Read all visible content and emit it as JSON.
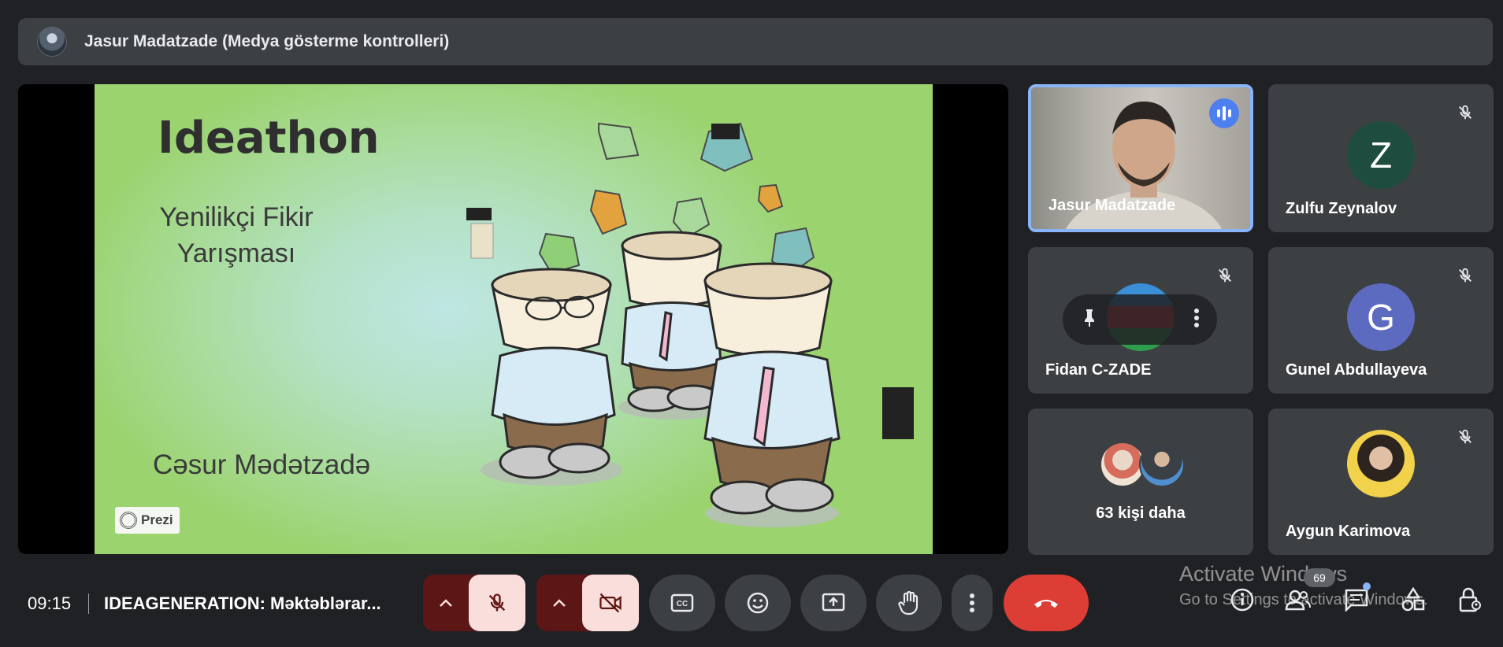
{
  "header": {
    "title": "Jasur Madatzade (Medya gösterme kontrolleri)"
  },
  "slide": {
    "title": "Ideathon",
    "subtitle_line1": "Yenilikçi Fikir",
    "subtitle_line2": "Yarışması",
    "author": "Cəsur Mədətzadə",
    "brand": "Prezi"
  },
  "participants": [
    {
      "name": "Jasur Madatzade",
      "speaking": true
    },
    {
      "name": "Zulfu Zeynalov",
      "initial": "Z",
      "color": "#1e4d3f",
      "muted": true
    },
    {
      "name": "Fidan C-ZADE",
      "muted": true
    },
    {
      "name": "Gunel Abdullayeva",
      "initial": "G",
      "color": "#5c6bc0",
      "muted": true
    },
    {
      "name": "Aygun Karimova",
      "muted": true
    }
  ],
  "more": {
    "label": "63 kişi daha"
  },
  "footer": {
    "time": "09:15",
    "meeting_title": "IDEAGENERATION: Məktəblərar...",
    "participant_count": "69"
  },
  "watermark": {
    "line1": "Activate Windows",
    "line2": "Go to Settings to activate Windows."
  },
  "colors": {
    "accent": "#8ab4f8",
    "end_call": "#dc3d34",
    "mic_off_bg": "#f9dedc",
    "group_bg": "#5c1616"
  }
}
